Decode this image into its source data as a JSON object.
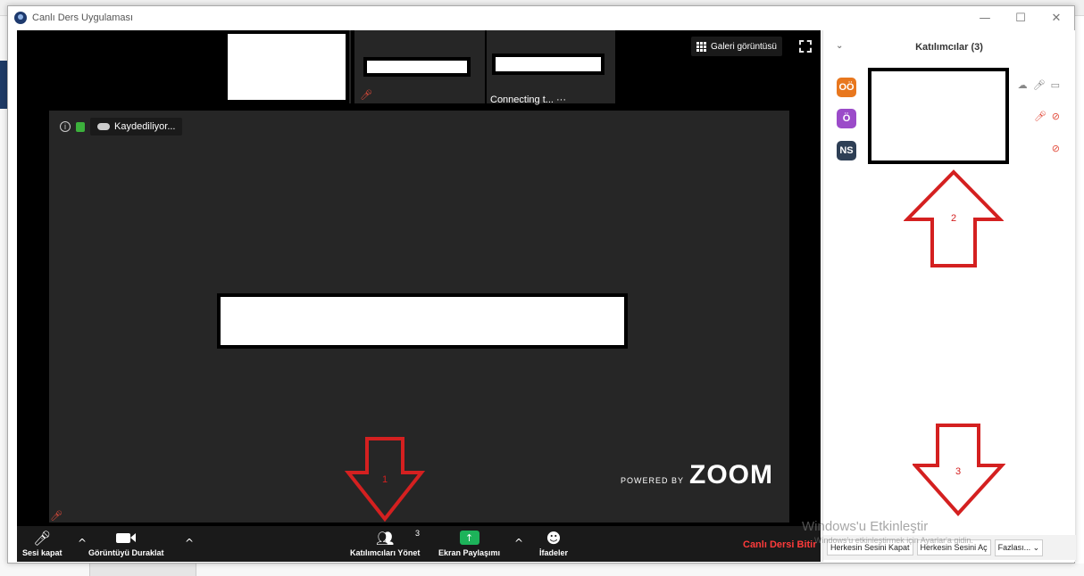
{
  "window": {
    "title": "Canlı Ders Uygulaması",
    "minimize": "—",
    "maximize": "☐",
    "close": "✕"
  },
  "video": {
    "connecting_label": "Connecting t...",
    "connecting_dots": "···",
    "gallery_label": "Galeri görüntüsü",
    "recording_label": "Kaydediliyor...",
    "powered_by": "POWERED BY",
    "brand": "ZOOM"
  },
  "toolbar": {
    "mute_label": "Sesi kapat",
    "video_label": "Görüntüyü Duraklat",
    "participants_label": "Katılımcıları Yönet",
    "participants_count": "3",
    "share_label": "Ekran Paylaşımı",
    "reactions_label": "İfadeler",
    "end_label": "Canlı Dersi Bitir"
  },
  "panel": {
    "title": "Katılımcılar (3)",
    "participants": [
      {
        "initials": "OÖ",
        "color": "#e8771e"
      },
      {
        "initials": "Ö",
        "color": "#9b4bc9"
      },
      {
        "initials": "NS",
        "color": "#2e3f55"
      }
    ],
    "mute_all_label": "Herkesin Sesini Kapat",
    "unmute_all_label": "Herkesin Sesini Aç",
    "more_label": "Fazlası..."
  },
  "annotations": {
    "arrow_1": "1",
    "arrow_2": "2",
    "arrow_3": "3",
    "color": "#d42020"
  },
  "watermark": {
    "line1": "Windows'u Etkinleştir",
    "line2": "Windows'u etkinleştirmek için Ayarlar'a gidin."
  }
}
